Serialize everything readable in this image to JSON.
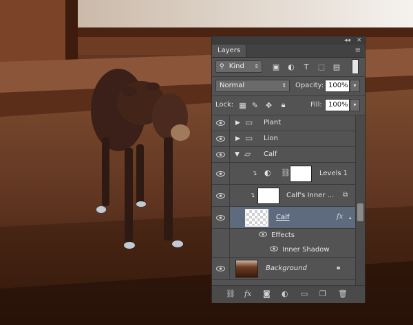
{
  "panel": {
    "title_tab": "Layers",
    "filter": {
      "kind_label": "Kind",
      "icons": [
        "image-filter-icon",
        "adjustment-filter-icon",
        "type-filter-icon",
        "shape-filter-icon",
        "smart-object-filter-icon",
        "filter-toggle-icon"
      ]
    },
    "blend_mode": "Normal",
    "opacity_label": "Opacity:",
    "opacity_value": "100%",
    "lock_label": "Lock:",
    "fill_label": "Fill:",
    "fill_value": "100%",
    "layers": [
      {
        "name": "Plant",
        "type": "group",
        "expanded": false
      },
      {
        "name": "Lion",
        "type": "group",
        "expanded": false
      },
      {
        "name": "Calf",
        "type": "group",
        "expanded": true
      },
      {
        "name": "Levels 1",
        "type": "adjustment",
        "clipped": true
      },
      {
        "name": "Calf's Inner ...",
        "type": "pixel",
        "clipped": true
      },
      {
        "name": "Calf",
        "type": "pixel",
        "selected": true,
        "fx": "fx"
      },
      {
        "name": "Effects",
        "type": "effects-header"
      },
      {
        "name": "Inner Shadow",
        "type": "effect"
      },
      {
        "name": "Background",
        "type": "background",
        "locked": true
      }
    ],
    "footer_icons": [
      "link-layers-icon",
      "fx-icon",
      "layer-mask-icon",
      "adjustment-layer-icon",
      "new-group-icon",
      "new-layer-icon",
      "delete-layer-icon"
    ]
  },
  "colors": {
    "panel_bg": "#535353",
    "selected_row": "#5e6b7f",
    "accent": "#e0e0e0"
  }
}
